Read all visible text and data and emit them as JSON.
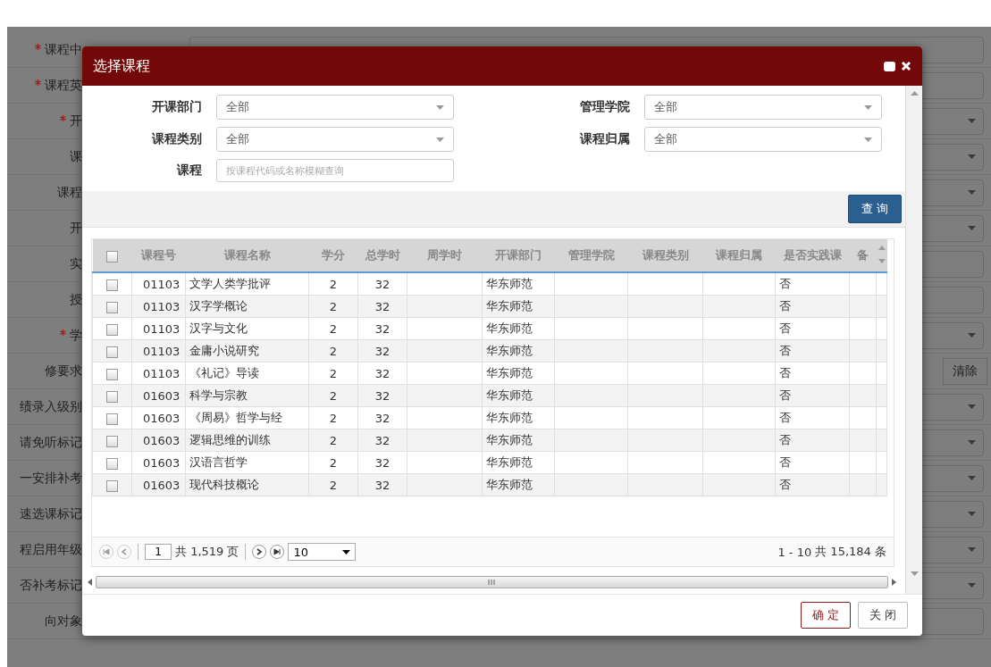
{
  "background_form": {
    "rows": [
      {
        "label": "课程中",
        "required": true,
        "kind": "text"
      },
      {
        "label": "课程英",
        "required": true,
        "kind": "text"
      },
      {
        "label": "开",
        "required": true,
        "kind": "select"
      },
      {
        "label": "课",
        "required": false,
        "kind": "select"
      },
      {
        "label": "课程",
        "required": false,
        "kind": "select"
      },
      {
        "label": "开",
        "required": false,
        "kind": "select"
      },
      {
        "label": "实",
        "required": false,
        "kind": "text"
      },
      {
        "label": "授",
        "required": false,
        "kind": "text"
      },
      {
        "label": "学",
        "required": true,
        "kind": "select"
      },
      {
        "label": "修要求",
        "required": false,
        "kind": "button",
        "button": "清除"
      },
      {
        "label": "绩录入级别",
        "required": false,
        "kind": "select"
      },
      {
        "label": "请免听标记",
        "required": false,
        "kind": "select"
      },
      {
        "label": "一安排补考",
        "required": false,
        "kind": "select"
      },
      {
        "label": "速选课标记",
        "required": false,
        "kind": "select"
      },
      {
        "label": "程启用年级",
        "required": false,
        "kind": "select"
      },
      {
        "label": "否补考标记",
        "required": false,
        "kind": "select"
      },
      {
        "label": "向对象",
        "required": false,
        "kind": "text"
      }
    ]
  },
  "dialog": {
    "title": "选择课程",
    "filters": [
      {
        "label": "开课部门",
        "kind": "select",
        "value": "全部"
      },
      {
        "label": "管理学院",
        "kind": "select",
        "value": "全部"
      },
      {
        "label": "课程类别",
        "kind": "select",
        "value": "全部"
      },
      {
        "label": "课程归属",
        "kind": "select",
        "value": "全部"
      },
      {
        "label": "课程",
        "kind": "text",
        "placeholder": "按课程代码或名称模糊查询"
      }
    ],
    "query_button": "查 询",
    "table": {
      "select_all_checked": false,
      "columns": [
        "课程号",
        "课程名称",
        "学分",
        "总学时",
        "周学时",
        "开课部门",
        "管理学院",
        "课程类别",
        "课程归属",
        "是否实践课",
        "备"
      ],
      "rows": [
        {
          "selected": false,
          "code": "01103",
          "name": "文学人类学批评",
          "credit": "2",
          "hours": "32",
          "dept": "华东师范",
          "practice": "否"
        },
        {
          "selected": false,
          "code": "01103",
          "name": "汉字学概论",
          "credit": "2",
          "hours": "32",
          "dept": "华东师范",
          "practice": "否"
        },
        {
          "selected": false,
          "code": "01103",
          "name": "汉字与文化",
          "credit": "2",
          "hours": "32",
          "dept": "华东师范",
          "practice": "否"
        },
        {
          "selected": false,
          "code": "01103",
          "name": "金庸小说研究",
          "credit": "2",
          "hours": "32",
          "dept": "华东师范",
          "practice": "否"
        },
        {
          "selected": false,
          "code": "01103",
          "name": "《礼记》导读",
          "credit": "2",
          "hours": "32",
          "dept": "华东师范",
          "practice": "否"
        },
        {
          "selected": false,
          "code": "01603",
          "name": "科学与宗教",
          "credit": "2",
          "hours": "32",
          "dept": "华东师范",
          "practice": "否"
        },
        {
          "selected": false,
          "code": "01603",
          "name": "《周易》哲学与经",
          "credit": "2",
          "hours": "32",
          "dept": "华东师范",
          "practice": "否"
        },
        {
          "selected": false,
          "code": "01603",
          "name": "逻辑思维的训练",
          "credit": "2",
          "hours": "32",
          "dept": "华东师范",
          "practice": "否"
        },
        {
          "selected": false,
          "code": "01603",
          "name": "汉语言哲学",
          "credit": "2",
          "hours": "32",
          "dept": "华东师范",
          "practice": "否"
        },
        {
          "selected": false,
          "code": "01603",
          "name": "现代科技概论",
          "credit": "2",
          "hours": "32",
          "dept": "华东师范",
          "practice": "否"
        }
      ]
    },
    "pager": {
      "first_disabled": true,
      "prev_disabled": true,
      "page": "1",
      "total_pages": "共 1,519 页",
      "page_size": "10",
      "range": "1 - 10",
      "total": "共 15,184 条"
    },
    "buttons": [
      {
        "label": "确 定",
        "kind": "primary"
      },
      {
        "label": "关 闭",
        "kind": "default"
      }
    ]
  }
}
